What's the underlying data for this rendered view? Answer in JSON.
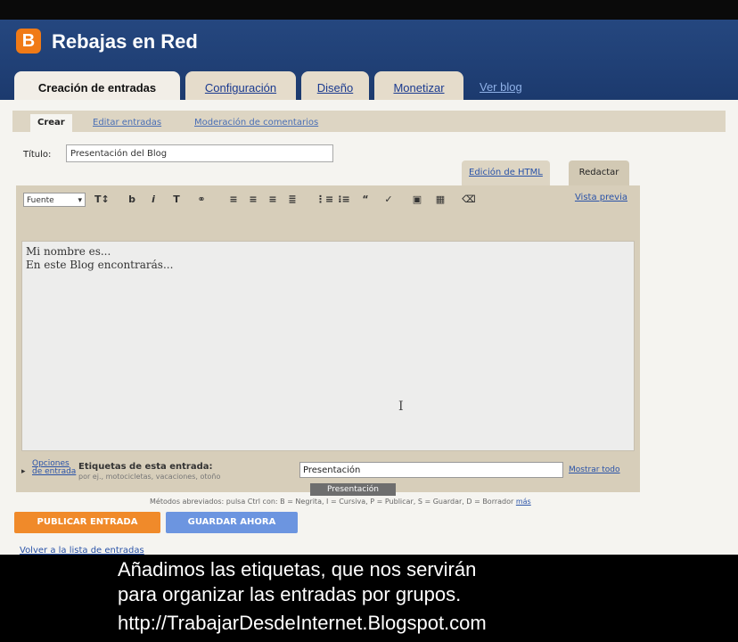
{
  "app": {
    "blog_name": "Rebajas en Red",
    "logo_letter": "B"
  },
  "tabs": [
    {
      "label": "Creación de entradas",
      "active": true
    },
    {
      "label": "Configuración"
    },
    {
      "label": "Diseño"
    },
    {
      "label": "Monetizar"
    }
  ],
  "view_blog": "Ver blog",
  "subtabs": [
    {
      "label": "Crear",
      "active": true
    },
    {
      "label": "Editar entradas"
    },
    {
      "label": "Moderación de comentarios"
    }
  ],
  "post": {
    "title_label": "Título:",
    "title_value": "Presentación del Blog",
    "mode_html": "Edición de HTML",
    "mode_compose": "Redactar",
    "font_select": "Fuente",
    "preview_link": "Vista previa",
    "body_lines": [
      "Mi nombre es...",
      "En este Blog encontrarás..."
    ]
  },
  "toolbar_icons": [
    "font-size-icon",
    "bold-icon",
    "italic-icon",
    "text-color-icon",
    "link-icon",
    "align-left-icon",
    "align-center-icon",
    "align-right-icon",
    "justify-icon",
    "numbered-list-icon",
    "bullet-list-icon",
    "blockquote-icon",
    "spellcheck-icon",
    "image-icon",
    "video-icon",
    "remove-format-icon"
  ],
  "options": {
    "link": "Opciones de entrada",
    "labels_title": "Etiquetas de esta entrada:",
    "labels_hint": "por ej., motocicletas, vacaciones, otoño",
    "labels_value": "Presentación",
    "show_all": "Mostrar todo",
    "suggestion": "Presentación"
  },
  "shortcuts_text": "Métodos abreviados: pulsa Ctrl con: B = Negrita, I = Cursiva, P = Publicar, S = Guardar, D = Borrador",
  "shortcuts_more": "más",
  "buttons": {
    "publish": "PUBLICAR ENTRADA",
    "save": "GUARDAR AHORA"
  },
  "back_link": "Volver a la lista de entradas",
  "caption": [
    "Añadimos las etiquetas, que nos servirán",
    "para organizar las entradas por grupos.",
    "http://TrabajarDesdeInternet.Blogspot.com"
  ],
  "colors": {
    "header": "#1c3a6e",
    "accent_orange": "#f08a2a",
    "accent_blue": "#6c95e0",
    "tan": "#ddd5c3"
  }
}
